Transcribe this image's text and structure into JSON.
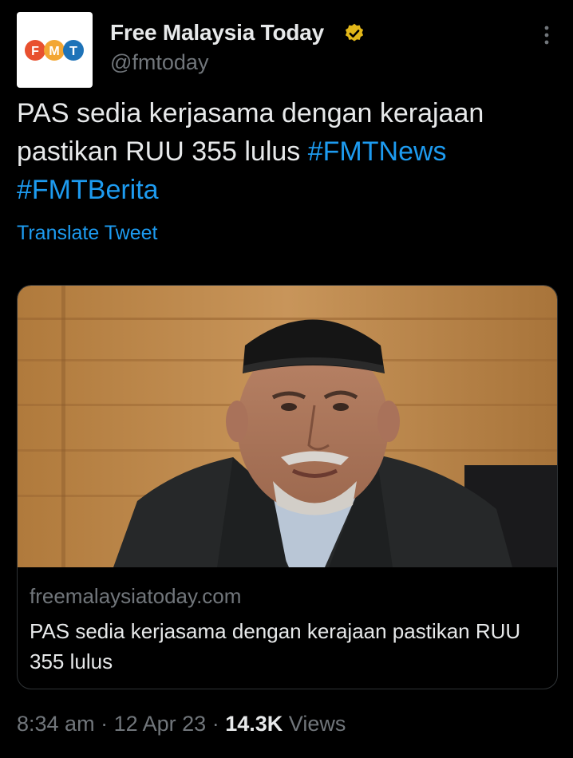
{
  "tweet": {
    "display_name": "Free Malaysia Today",
    "handle": "@fmtoday",
    "text_prefix": "PAS sedia kerjasama dengan kerajaan pastikan RUU 355 lulus ",
    "hashtags": [
      "#FMTNews",
      "#FMTBerita"
    ],
    "translate_label": "Translate Tweet"
  },
  "avatar": {
    "letters": [
      "F",
      "M",
      "T"
    ],
    "colors": [
      "#e8502f",
      "#f3a632",
      "#1e73b8"
    ]
  },
  "card": {
    "domain": "freemalaysiatoday.com",
    "title": "PAS sedia kerjasama dengan kerajaan pastikan RUU 355 lulus"
  },
  "meta": {
    "time": "8:34 am",
    "separator": "·",
    "date": "12 Apr 23",
    "views_count": "14.3K",
    "views_label": "Views"
  },
  "colors": {
    "background": "#000000",
    "text": "#e7e9ea",
    "secondary": "#71767b",
    "link": "#1d9bf0",
    "verified_badge": "#e2b719"
  }
}
